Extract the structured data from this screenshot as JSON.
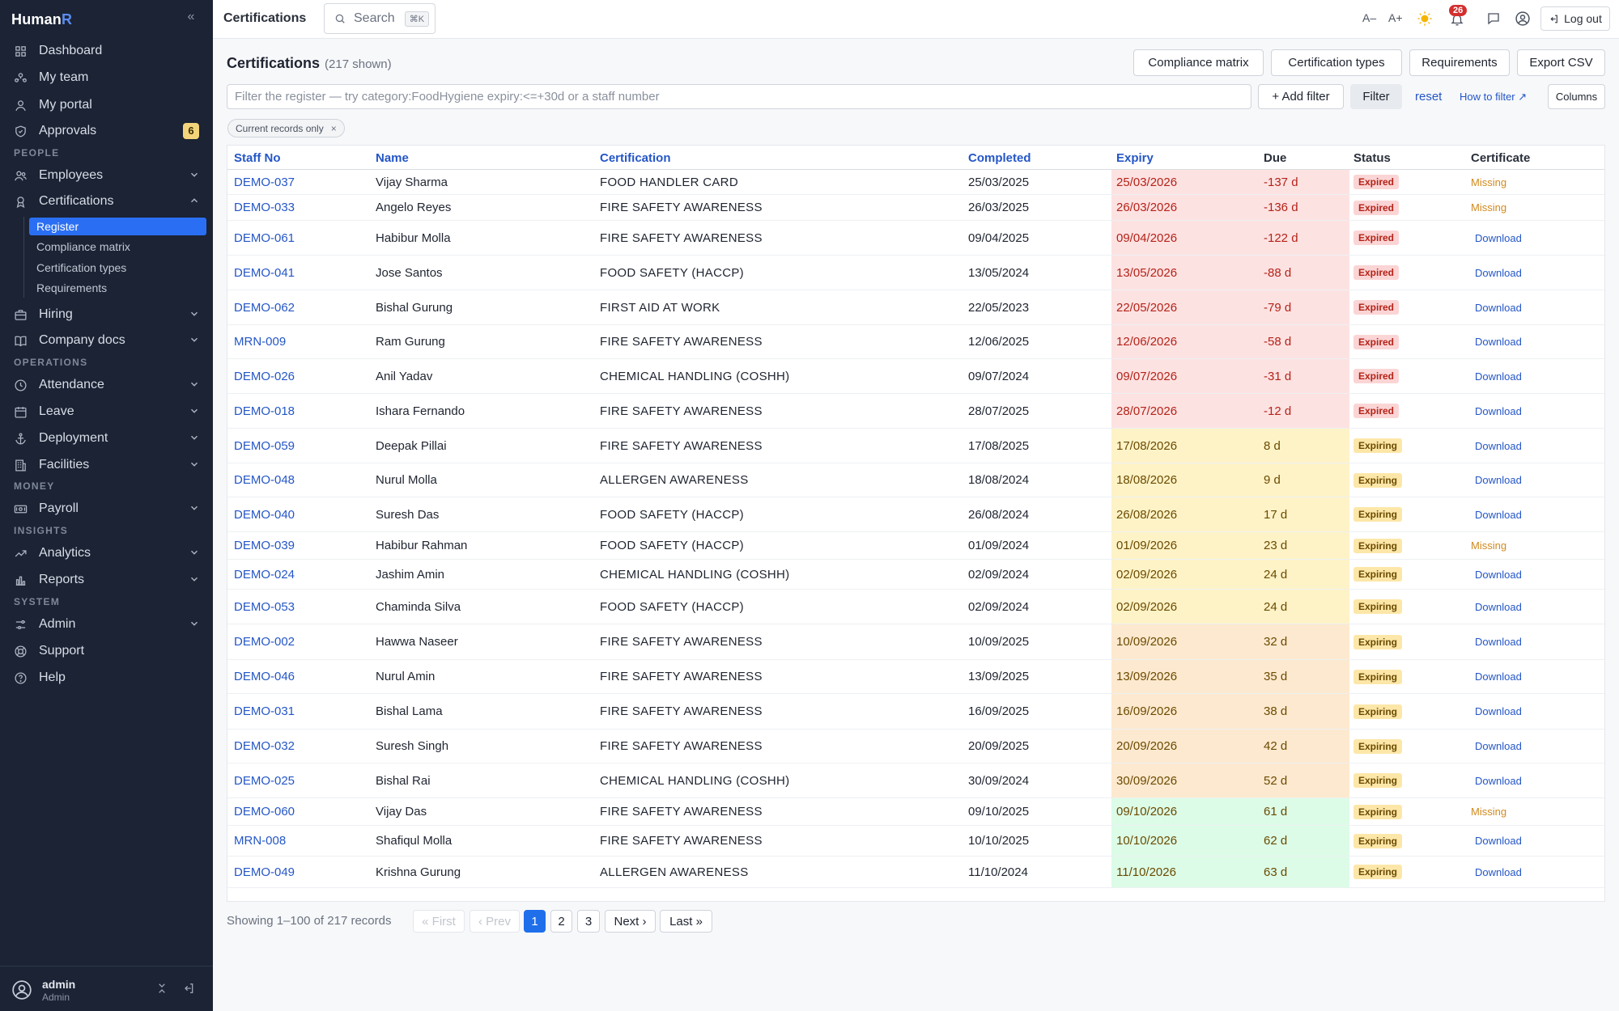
{
  "brand": {
    "name": "Human",
    "accent": "R"
  },
  "sidebar": {
    "items": [
      {
        "label": "Dashboard",
        "icon": "grid-icon"
      },
      {
        "label": "My team",
        "icon": "team-icon"
      },
      {
        "label": "My portal",
        "icon": "person-icon"
      },
      {
        "label": "Approvals",
        "icon": "shield-check-icon",
        "badge": "6"
      }
    ],
    "sections": {
      "people": "PEOPLE",
      "operations": "OPERATIONS",
      "money": "MONEY",
      "insights": "INSIGHTS",
      "system": "SYSTEM"
    },
    "people_items": [
      {
        "label": "Employees",
        "icon": "users-icon"
      },
      {
        "label": "Certifications",
        "icon": "award-icon"
      }
    ],
    "cert_sub": [
      "Register",
      "Compliance matrix",
      "Certification types",
      "Requirements"
    ],
    "people_more": [
      {
        "label": "Hiring",
        "icon": "briefcase-icon"
      },
      {
        "label": "Company docs",
        "icon": "book-icon"
      }
    ],
    "operations_items": [
      {
        "label": "Attendance",
        "icon": "clock-icon"
      },
      {
        "label": "Leave",
        "icon": "calendar-icon"
      },
      {
        "label": "Deployment",
        "icon": "anchor-icon"
      },
      {
        "label": "Facilities",
        "icon": "building-icon"
      }
    ],
    "money_items": [
      {
        "label": "Payroll",
        "icon": "cash-icon"
      }
    ],
    "insights_items": [
      {
        "label": "Analytics",
        "icon": "trend-icon"
      },
      {
        "label": "Reports",
        "icon": "bar-chart-icon"
      }
    ],
    "system_items": [
      {
        "label": "Admin",
        "icon": "sliders-icon"
      },
      {
        "label": "Support",
        "icon": "lifebuoy-icon"
      },
      {
        "label": "Help",
        "icon": "help-icon"
      }
    ],
    "user": {
      "name": "admin",
      "role": "Admin"
    }
  },
  "topbar": {
    "title": "Certifications",
    "search_label": "Search",
    "search_kbd": "⌘K",
    "font_smaller": "A–",
    "font_larger": "A+",
    "notif_count": "26",
    "logout": "Log out"
  },
  "main": {
    "title": "Certifications",
    "shown": "(217 shown)",
    "actions": [
      "Compliance matrix",
      "Certification types",
      "Requirements",
      "Export CSV"
    ],
    "filter_placeholder": "Filter the register — try category:FoodHygiene expiry:<=+30d or a staff number",
    "add_filter": "+ Add filter",
    "filter_btn": "Filter",
    "reset": "reset",
    "how_to": "How to filter ↗",
    "columns": "Columns",
    "chip": "Current records only",
    "chip_x": "×"
  },
  "table": {
    "headers": [
      "Staff No",
      "Name",
      "Certification",
      "Completed",
      "Expiry",
      "Due",
      "Status",
      "Certificate"
    ],
    "rows": [
      [
        "DEMO-037",
        "Vijay Sharma",
        "FOOD HANDLER CARD",
        "25/03/2025",
        "25/03/2026",
        "-137 d",
        "Expired",
        "Missing"
      ],
      [
        "DEMO-033",
        "Angelo Reyes",
        "FIRE SAFETY AWARENESS",
        "26/03/2025",
        "26/03/2026",
        "-136 d",
        "Expired",
        "Missing"
      ],
      [
        "DEMO-061",
        "Habibur Molla",
        "FIRE SAFETY AWARENESS",
        "09/04/2025",
        "09/04/2026",
        "-122 d",
        "Expired",
        "Download"
      ],
      [
        "DEMO-041",
        "Jose Santos",
        "FOOD SAFETY (HACCP)",
        "13/05/2024",
        "13/05/2026",
        "-88 d",
        "Expired",
        "Download"
      ],
      [
        "DEMO-062",
        "Bishal Gurung",
        "FIRST AID AT WORK",
        "22/05/2023",
        "22/05/2026",
        "-79 d",
        "Expired",
        "Download"
      ],
      [
        "MRN-009",
        "Ram Gurung",
        "FIRE SAFETY AWARENESS",
        "12/06/2025",
        "12/06/2026",
        "-58 d",
        "Expired",
        "Download"
      ],
      [
        "DEMO-026",
        "Anil Yadav",
        "CHEMICAL HANDLING (COSHH)",
        "09/07/2024",
        "09/07/2026",
        "-31 d",
        "Expired",
        "Download"
      ],
      [
        "DEMO-018",
        "Ishara Fernando",
        "FIRE SAFETY AWARENESS",
        "28/07/2025",
        "28/07/2026",
        "-12 d",
        "Expired",
        "Download"
      ],
      [
        "DEMO-059",
        "Deepak Pillai",
        "FIRE SAFETY AWARENESS",
        "17/08/2025",
        "17/08/2026",
        "8 d",
        "Expiring",
        "Download"
      ],
      [
        "DEMO-048",
        "Nurul Molla",
        "ALLERGEN AWARENESS",
        "18/08/2024",
        "18/08/2026",
        "9 d",
        "Expiring",
        "Download"
      ],
      [
        "DEMO-040",
        "Suresh Das",
        "FOOD SAFETY (HACCP)",
        "26/08/2024",
        "26/08/2026",
        "17 d",
        "Expiring",
        "Download"
      ],
      [
        "DEMO-039",
        "Habibur Rahman",
        "FOOD SAFETY (HACCP)",
        "01/09/2024",
        "01/09/2026",
        "23 d",
        "Expiring",
        "Missing"
      ],
      [
        "DEMO-024",
        "Jashim Amin",
        "CHEMICAL HANDLING (COSHH)",
        "02/09/2024",
        "02/09/2026",
        "24 d",
        "Expiring",
        "Download"
      ],
      [
        "DEMO-053",
        "Chaminda Silva",
        "FOOD SAFETY (HACCP)",
        "02/09/2024",
        "02/09/2026",
        "24 d",
        "Expiring",
        "Download"
      ],
      [
        "DEMO-002",
        "Hawwa Naseer",
        "FIRE SAFETY AWARENESS",
        "10/09/2025",
        "10/09/2026",
        "32 d",
        "Expiring",
        "Download"
      ],
      [
        "DEMO-046",
        "Nurul Amin",
        "FIRE SAFETY AWARENESS",
        "13/09/2025",
        "13/09/2026",
        "35 d",
        "Expiring",
        "Download"
      ],
      [
        "DEMO-031",
        "Bishal Lama",
        "FIRE SAFETY AWARENESS",
        "16/09/2025",
        "16/09/2026",
        "38 d",
        "Expiring",
        "Download"
      ],
      [
        "DEMO-032",
        "Suresh Singh",
        "FIRE SAFETY AWARENESS",
        "20/09/2025",
        "20/09/2026",
        "42 d",
        "Expiring",
        "Download"
      ],
      [
        "DEMO-025",
        "Bishal Rai",
        "CHEMICAL HANDLING (COSHH)",
        "30/09/2024",
        "30/09/2026",
        "52 d",
        "Expiring",
        "Download"
      ],
      [
        "DEMO-060",
        "Vijay Das",
        "FIRE SAFETY AWARENESS",
        "09/10/2025",
        "09/10/2026",
        "61 d",
        "Expiring",
        "Missing"
      ],
      [
        "MRN-008",
        "Shafiqul Molla",
        "FIRE SAFETY AWARENESS",
        "10/10/2025",
        "10/10/2026",
        "62 d",
        "Expiring",
        "Download"
      ],
      [
        "DEMO-049",
        "Krishna Gurung",
        "ALLERGEN AWARENESS",
        "11/10/2024",
        "11/10/2026",
        "63 d",
        "Expiring",
        "Download"
      ]
    ],
    "colors": {
      "expired_bg": "#fde2e2",
      "soon_bg": "#fef3c7",
      "mid_bg": "#fde9cf",
      "later_bg": "#dcfce7"
    }
  },
  "pagination": {
    "summary": "Showing 1–100 of 217 records",
    "first": "« First",
    "prev": "‹ Prev",
    "pages": [
      "1",
      "2",
      "3"
    ],
    "next": "Next ›",
    "last": "Last »"
  }
}
